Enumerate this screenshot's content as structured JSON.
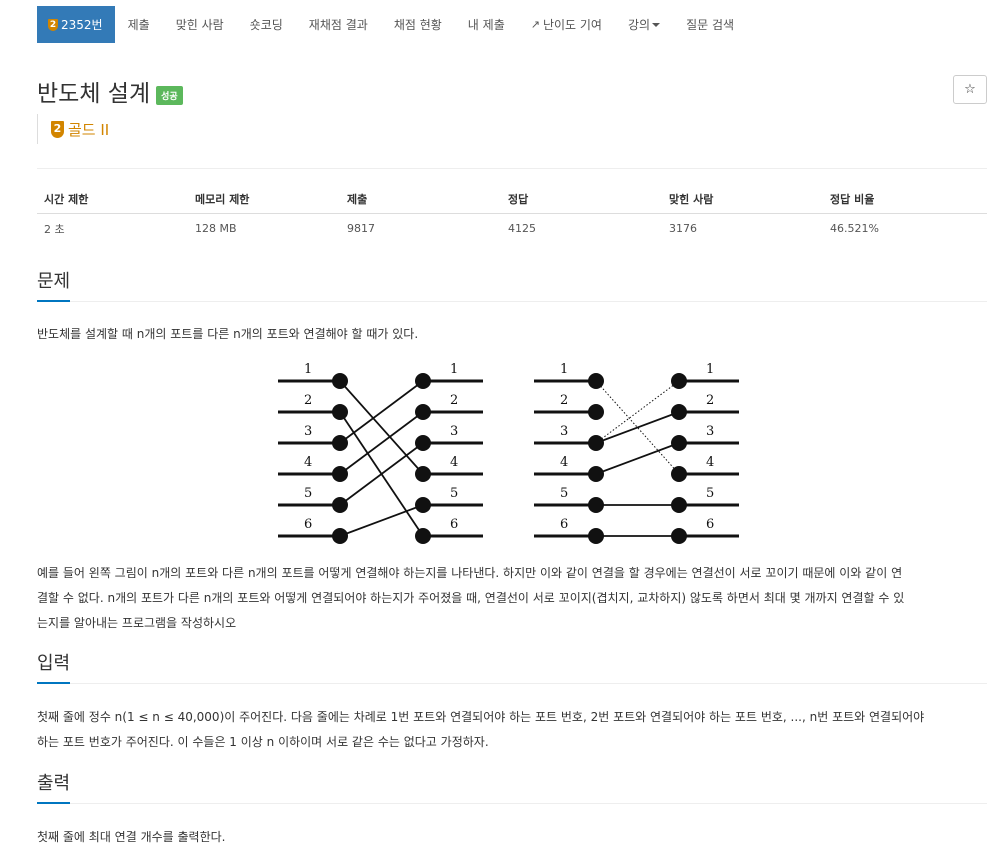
{
  "nav": {
    "problem_number": "2352번",
    "tier_icon_text": "2",
    "items": [
      "제출",
      "맞힌 사람",
      "숏코딩",
      "재채점 결과",
      "채점 현황",
      "내 제출",
      "난이도 기여",
      "강의",
      "질문 검색"
    ]
  },
  "problem": {
    "title": "반도체 설계",
    "status_badge": "성공",
    "tier_icon_text": "2",
    "tier_label": "골드 II",
    "star_icon": "☆"
  },
  "info": {
    "headers": [
      "시간 제한",
      "메모리 제한",
      "제출",
      "정답",
      "맞힌 사람",
      "정답 비율"
    ],
    "values": [
      "2 초",
      "128 MB",
      "9817",
      "4125",
      "3176",
      "46.521%"
    ]
  },
  "sections": {
    "problem_title": "문제",
    "problem_intro": "반도체를 설계할 때 n개의 포트를 다른 n개의 포트와 연결해야 할 때가 있다.",
    "problem_body": [
      "예를 들어 왼쪽 그림이 n개의 포트와 다른 n개의 포트를 어떻게 연결해야 하는지를 나타낸다. 하지만 이와 같이 연결을 할 경우에는 연결선이 서로 꼬이기 때문에 이와 같이 연",
      "결할 수 없다. n개의 포트가 다른 n개의 포트와 어떻게 연결되어야 하는지가 주어졌을 때, 연결선이 서로 꼬이지(겹치지, 교차하지) 않도록 하면서 최대 몇 개까지 연결할 수 있",
      "는지를 알아내는 프로그램을 작성하시오"
    ],
    "input_title": "입력",
    "input_body": [
      "첫째 줄에 정수 n(1 ≤ n ≤ 40,000)이 주어진다. 다음 줄에는 차례로 1번 포트와 연결되어야 하는 포트 번호, 2번 포트와 연결되어야 하는 포트 번호, ..., n번 포트와 연결되어야",
      "하는 포트 번호가 주어진다. 이 수들은 1 이상 n 이하이며 서로 같은 수는 없다고 가정하자."
    ],
    "output_title": "출력",
    "output_body": "첫째 줄에 최대 연결 개수를 출력한다."
  },
  "figure": {
    "port_labels": [
      "1",
      "2",
      "3",
      "4",
      "5",
      "6"
    ],
    "left_connections": [
      4,
      6,
      1,
      2,
      3,
      5
    ],
    "right_solid_connections": [
      2,
      3,
      5,
      6
    ],
    "right_dotted_connections": [
      [
        1,
        4
      ],
      [
        3,
        1
      ]
    ]
  },
  "colors": {
    "nav_active_bg": "#337ab7",
    "success_badge": "#5cb85c",
    "gold_tier": "#d28500",
    "section_underline": "#0076c0"
  }
}
